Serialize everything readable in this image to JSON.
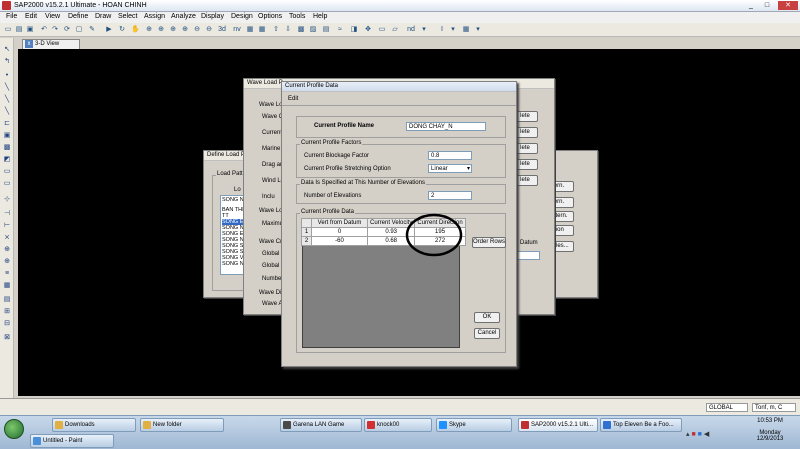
{
  "window": {
    "title": "SAP2000 v15.2.1 Ultimate  -  HOAN CHINH",
    "min": "_",
    "max": "□",
    "close": "✕"
  },
  "menu": [
    "File",
    "Edit",
    "View",
    "Define",
    "Draw",
    "Select",
    "Assign",
    "Analyze",
    "Display",
    "Design",
    "Options",
    "Tools",
    "Help"
  ],
  "toolbar": {
    "nv_label": "nv",
    "nd_label": "nd"
  },
  "view_tab": {
    "label": "3-D View"
  },
  "bg_dialog_define_load": {
    "title": "Define Load P",
    "group": "Load Patter",
    "list_label": "Lo",
    "list_items": [
      "SONG N",
      "BAN THI",
      "TT",
      "SONG E",
      "SONG N",
      "SONG E",
      "SONG N",
      "SONG S",
      "SONG S",
      "SONG V",
      "SONG N"
    ]
  },
  "bg_dialog_wave_load": {
    "title": "Wave Load P",
    "labels": [
      "Wave Lo",
      "Wave C",
      "Current",
      "Marine",
      "Drag an",
      "Wind Lo",
      "Inclu",
      "Wave Lo",
      "Maximum",
      "Wave Cr",
      "Global X",
      "Global Y",
      "Number",
      "Wave Di",
      "Wave A"
    ],
    "buttons": [
      "lete",
      "lete",
      "lete",
      "lete",
      "lete"
    ],
    "right_buttons": [
      "ern.",
      "ern.",
      "attern.",
      "tion",
      "ables..."
    ],
    "datum_label": "Datum"
  },
  "dialog": {
    "title": "Current Profile Data",
    "menu_edit": "Edit",
    "profile_name_label": "Current Profile Name",
    "profile_name_value": "DONG CHAY_N",
    "factors_group": "Current Profile Factors",
    "blockage_label": "Current Blockage Factor",
    "blockage_value": "0.8",
    "stretch_label": "Current Profile Stretching Option",
    "stretch_value": "Linear",
    "elev_group": "Data Is Specified at This Number of Elevations",
    "num_elev_label": "Number of Elevations",
    "num_elev_value": "2",
    "data_group": "Current Profile Data",
    "table_headers": [
      "Vert from Datum",
      "Current Velocity",
      "Current Direction"
    ],
    "rows": [
      {
        "idx": "1",
        "vert": "0",
        "vel": "0.93",
        "dir": "195"
      },
      {
        "idx": "2",
        "vert": "-60",
        "vel": "0.68",
        "dir": "272"
      }
    ],
    "order_rows_btn": "Order Rows",
    "ok_btn": "OK",
    "cancel_btn": "Cancel"
  },
  "status": {
    "units_select": "GLOBAL",
    "units_right": "Tonf, m, C"
  },
  "taskbar": {
    "items": [
      {
        "label": "Downloads",
        "ico": ""
      },
      {
        "label": "New folder",
        "ico": ""
      },
      {
        "label": "Garena LAN Game",
        "ico": "gar"
      },
      {
        "label": "knock00",
        "ico": "red"
      },
      {
        "label": "Skype",
        "ico": "sky"
      },
      {
        "label": "SAP2000 v15.2.1 Ulti...",
        "ico": "sap"
      },
      {
        "label": "Top Eleven Be a Foo...",
        "ico": "ten"
      },
      {
        "label": "Untitled - Paint",
        "ico": "paint"
      }
    ],
    "time": "10:53 PM",
    "day": "Monday",
    "date": "12/9/2013"
  },
  "colors": {
    "annotation_circle": "#000000",
    "canvas": "#000000",
    "dialog_bg": "#d4d0c8"
  }
}
